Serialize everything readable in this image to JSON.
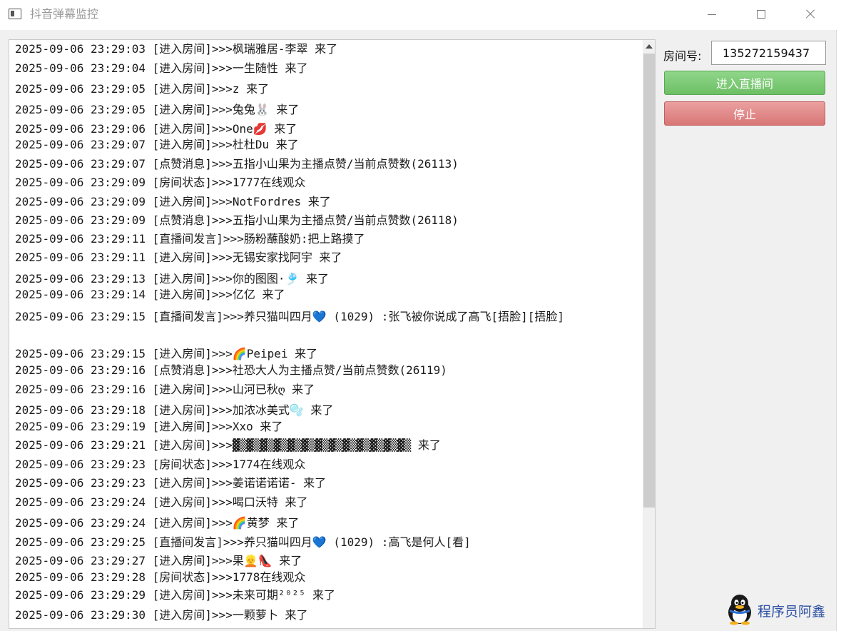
{
  "window": {
    "title": "抖音弹幕监控",
    "icons": {
      "app": "window-app-icon",
      "minimize": "minimize-icon",
      "maximize": "maximize-icon",
      "close": "close-icon"
    }
  },
  "log": {
    "lines": [
      "2025-09-06 23:29:03 [进入房间]>>>枫瑞雅居-李翠 来了",
      "2025-09-06 23:29:04 [进入房间]>>>一生随性 来了",
      "2025-09-06 23:29:05 [进入房间]>>>z 来了",
      "2025-09-06 23:29:05 [进入房间]>>>兔兔🐰 来了",
      "2025-09-06 23:29:06 [进入房间]>>>One💋 来了",
      "2025-09-06 23:29:07 [进入房间]>>>杜杜Du 来了",
      "2025-09-06 23:29:07 [点赞消息]>>>五指小山果为主播点赞/当前点赞数(26113)",
      "2025-09-06 23:29:09 [房间状态]>>>1777在线观众",
      "2025-09-06 23:29:09 [进入房间]>>>NotFordres 来了",
      "2025-09-06 23:29:09 [点赞消息]>>>五指小山果为主播点赞/当前点赞数(26118)",
      "2025-09-06 23:29:11 [直播间发言]>>>肠粉蘸酸奶:把上路摸了",
      "2025-09-06 23:29:11 [进入房间]>>>无锡安家找阿宇 来了",
      "2025-09-06 23:29:13 [进入房间]>>>你的图图·🎐 来了",
      "2025-09-06 23:29:14 [进入房间]>>>亿亿 来了",
      "2025-09-06 23:29:15 [直播间发言]>>>养只猫叫四月💙 (1029) :张飞被你说成了高飞[捂脸][捂脸]",
      "2025-09-06 23:29:15 [进入房间]>>>🌈Peipei 来了",
      "2025-09-06 23:29:16 [点赞消息]>>>社恐大人为主播点赞/当前点赞数(26119)",
      "2025-09-06 23:29:16 [进入房间]>>>山河已秋ღ 来了",
      "2025-09-06 23:29:18 [进入房间]>>>加浓冰美式🫧 来了",
      "2025-09-06 23:29:19 [进入房间]>>>Xxo 来了",
      "2025-09-06 23:29:21 [进入房间]>>>▓▒▓▒▓▒▓▒▓▒▓▒▓▒▓▒▓▒▓▒▓▒▓▒▓▒ 来了",
      "2025-09-06 23:29:23 [房间状态]>>>1774在线观众",
      "2025-09-06 23:29:23 [进入房间]>>>姜诺诺诺诺- 来了",
      "2025-09-06 23:29:24 [进入房间]>>>喝口沃特 来了",
      "2025-09-06 23:29:24 [进入房间]>>>🌈黄梦 来了",
      "2025-09-06 23:29:25 [直播间发言]>>>养只猫叫四月💙 (1029) :高飞是何人[看]",
      "2025-09-06 23:29:27 [进入房间]>>>果👱👠 来了",
      "2025-09-06 23:29:28 [房间状态]>>>1778在线观众",
      "2025-09-06 23:29:29 [进入房间]>>>未来可期²⁰²⁵ 来了",
      "2025-09-06 23:29:30 [进入房间]>>>一颗萝卜 来了"
    ]
  },
  "controls": {
    "room_label": "房间号:",
    "room_value": "135272159437",
    "enter_label": "进入直播间",
    "stop_label": "停止",
    "colors": {
      "enter": "#7fcb77",
      "stop": "#e08a8a"
    }
  },
  "watermark": {
    "text": "程序员阿鑫",
    "icon": "penguin-icon"
  }
}
